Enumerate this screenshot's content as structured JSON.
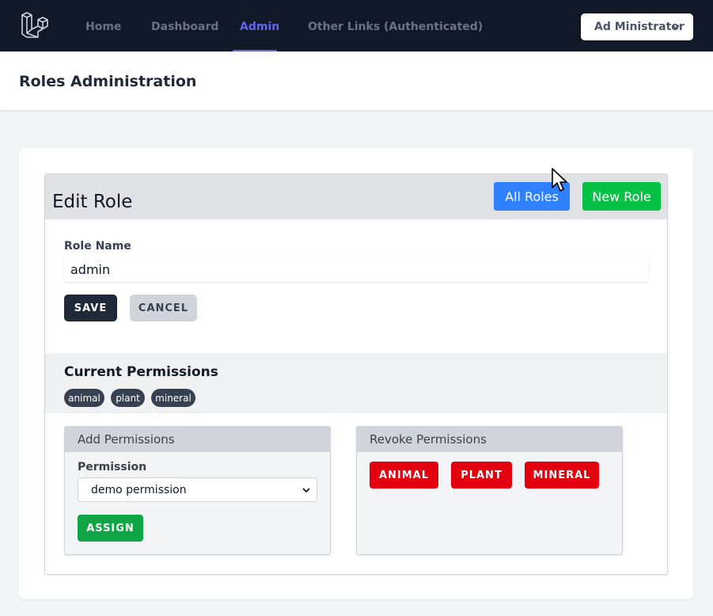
{
  "nav": {
    "links": [
      {
        "label": "Home"
      },
      {
        "label": "Dashboard"
      },
      {
        "label": "Admin"
      },
      {
        "label": "Other Links (Authenticated)"
      }
    ],
    "user_menu": "Ad Ministrator"
  },
  "header": {
    "title": "Roles Administration"
  },
  "edit_role": {
    "title": "Edit Role",
    "all_roles_button": "All Roles",
    "new_role_button": "New Role",
    "role_name_label": "Role Name",
    "role_name_value": "admin",
    "save_button": "SAVE",
    "cancel_button": "CANCEL"
  },
  "current_permissions": {
    "title": "Current Permissions",
    "items": [
      "animal",
      "plant",
      "mineral"
    ]
  },
  "add_permissions": {
    "title": "Add Permissions",
    "permission_label": "Permission",
    "selected_option": "demo permission",
    "assign_button": "ASSIGN"
  },
  "revoke_permissions": {
    "title": "Revoke Permissions",
    "buttons": [
      "ANIMAL",
      "PLANT",
      "MINERAL"
    ]
  },
  "colors": {
    "nav_bg": "#111827",
    "active_link": "#6366f1",
    "blue_button": "#2f80ff",
    "green_button": "#05c146",
    "assign_button": "#11a545",
    "revoke_button": "#e3000f"
  },
  "icons": {
    "logo": "laravel-logo-icon",
    "user_menu": "chevron-down-icon",
    "select": "chevron-down-icon",
    "cursor": "mouse-pointer-icon"
  }
}
